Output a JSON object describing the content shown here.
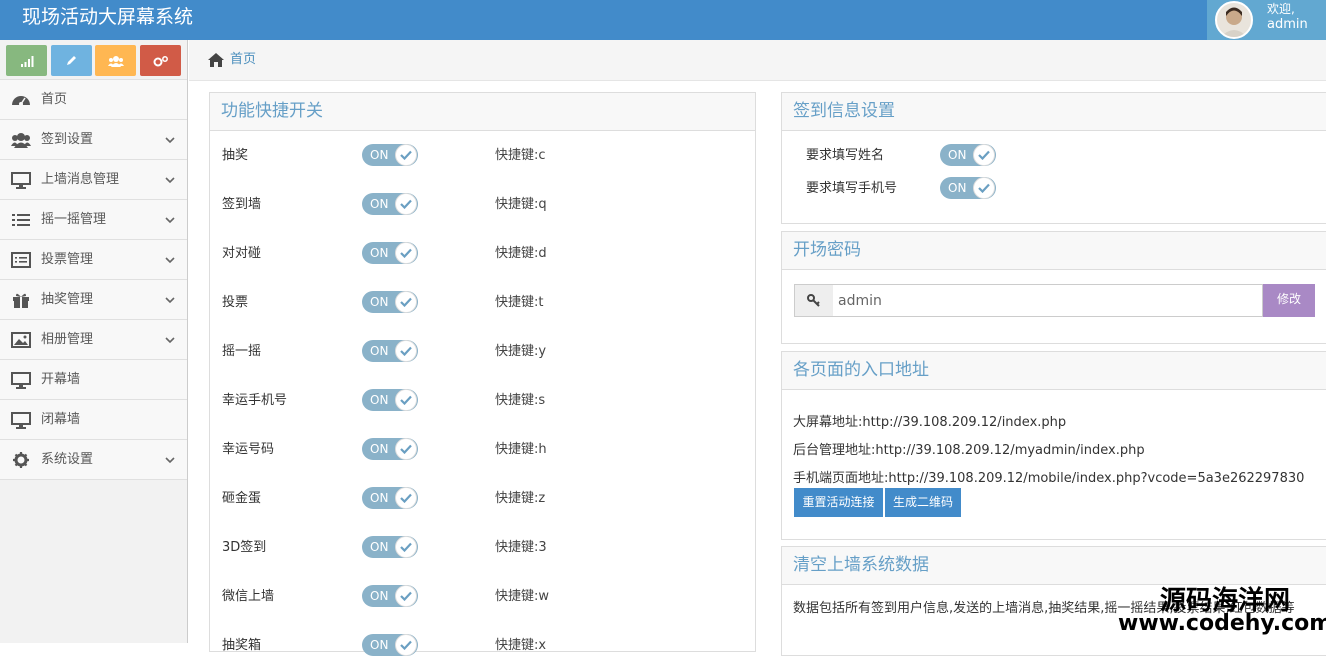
{
  "header": {
    "app_title": "现场活动大屏幕系统",
    "welcome": "欢迎,",
    "username": "admin"
  },
  "sidebar": {
    "items": [
      {
        "label": "首页",
        "icon": "dashboard-icon",
        "has_submenu": false
      },
      {
        "label": "签到设置",
        "icon": "users-icon",
        "has_submenu": true
      },
      {
        "label": "上墙消息管理",
        "icon": "desktop-icon",
        "has_submenu": true
      },
      {
        "label": "摇一摇管理",
        "icon": "list-icon",
        "has_submenu": true
      },
      {
        "label": "投票管理",
        "icon": "list-alt-icon",
        "has_submenu": true
      },
      {
        "label": "抽奖管理",
        "icon": "gift-icon",
        "has_submenu": true
      },
      {
        "label": "相册管理",
        "icon": "picture-icon",
        "has_submenu": true
      },
      {
        "label": "开幕墙",
        "icon": "desktop-icon",
        "has_submenu": false
      },
      {
        "label": "闭幕墙",
        "icon": "desktop-icon",
        "has_submenu": false
      },
      {
        "label": "系统设置",
        "icon": "cog-icon",
        "has_submenu": true
      }
    ],
    "shortcut_colors": [
      "#87b87f",
      "#6fb3e0",
      "#ffb752",
      "#d15b47"
    ]
  },
  "breadcrumb": {
    "home": "首页"
  },
  "features_panel": {
    "title": "功能快捷开关",
    "rows": [
      {
        "label": "抽奖",
        "toggle": "ON",
        "hotkey": "快捷键:c"
      },
      {
        "label": "签到墙",
        "toggle": "ON",
        "hotkey": "快捷键:q"
      },
      {
        "label": "对对碰",
        "toggle": "ON",
        "hotkey": "快捷键:d"
      },
      {
        "label": "投票",
        "toggle": "ON",
        "hotkey": "快捷键:t"
      },
      {
        "label": "摇一摇",
        "toggle": "ON",
        "hotkey": "快捷键:y"
      },
      {
        "label": "幸运手机号",
        "toggle": "ON",
        "hotkey": "快捷键:s"
      },
      {
        "label": "幸运号码",
        "toggle": "ON",
        "hotkey": "快捷键:h"
      },
      {
        "label": "砸金蛋",
        "toggle": "ON",
        "hotkey": "快捷键:z"
      },
      {
        "label": "3D签到",
        "toggle": "ON",
        "hotkey": "快捷键:3"
      },
      {
        "label": "微信上墙",
        "toggle": "ON",
        "hotkey": "快捷键:w"
      },
      {
        "label": "抽奖箱",
        "toggle": "ON",
        "hotkey": "快捷键:x"
      }
    ]
  },
  "signin_panel": {
    "title": "签到信息设置",
    "rows": [
      {
        "label": "要求填写姓名",
        "toggle": "ON"
      },
      {
        "label": "要求填写手机号",
        "toggle": "ON"
      }
    ]
  },
  "password_panel": {
    "title": "开场密码",
    "value": "admin",
    "button": "修改"
  },
  "urls_panel": {
    "title": "各页面的入口地址",
    "lines": [
      "大屏幕地址:http://39.108.209.12/index.php",
      "后台管理地址:http://39.108.209.12/myadmin/index.php",
      "手机端页面地址:http://39.108.209.12/mobile/index.php?vcode=5a3e262297830"
    ],
    "reset_button": "重置活动连接",
    "qr_button": "生成二维码"
  },
  "clear_panel": {
    "title": "清空上墙系统数据",
    "text": "数据包括所有签到用户信息,发送的上墙消息,抽奖结果,摇一摇结果,投票结果,红包数据等"
  },
  "watermark": {
    "line1": "源码海洋网",
    "line2": "www.codehy.com"
  }
}
